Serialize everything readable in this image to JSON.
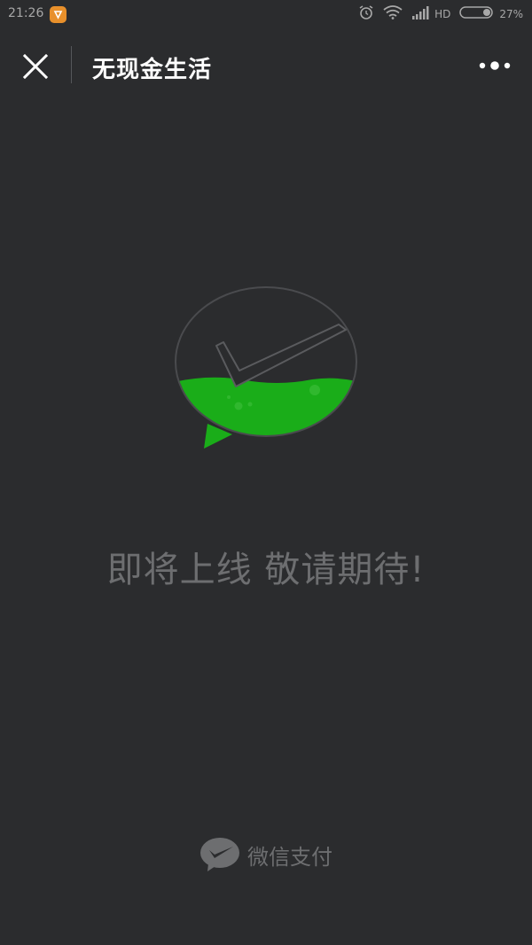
{
  "status_bar": {
    "time": "21:26",
    "network": "HD",
    "battery": "27%"
  },
  "header": {
    "title": "无现金生活",
    "close_icon": "close-icon",
    "more_icon": "more-dots-icon"
  },
  "main": {
    "logo_icon": "wechat-pay-logo-icon",
    "message": "即将上线 敬请期待!"
  },
  "footer": {
    "brand_icon": "wechat-pay-icon",
    "brand_label": "微信支付"
  },
  "colors": {
    "background": "#2b2c2e",
    "accent_green": "#1aad19",
    "muted_text": "#6d6e70"
  }
}
